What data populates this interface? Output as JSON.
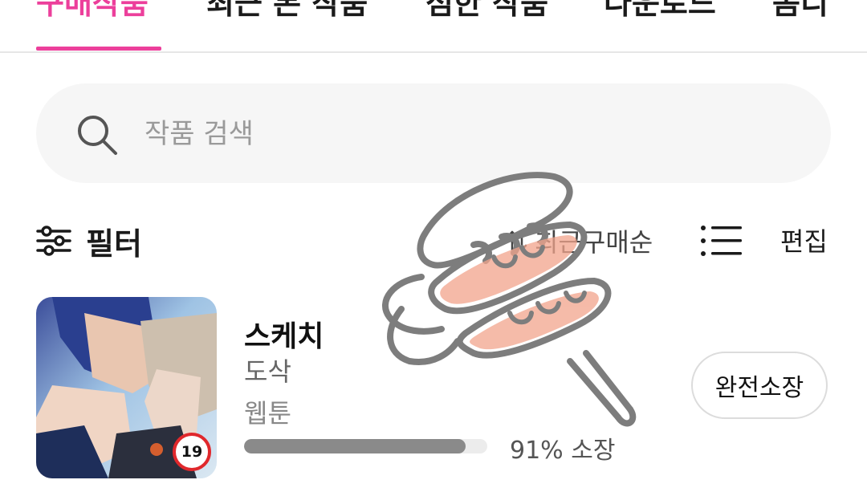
{
  "tabs": [
    {
      "label": "구매작품",
      "active": true
    },
    {
      "label": "최근 본 작품",
      "active": false
    },
    {
      "label": "점한 작품",
      "active": false
    },
    {
      "label": "다운로드",
      "active": false
    },
    {
      "label": "몸디",
      "active": false
    }
  ],
  "search": {
    "placeholder": "작품 검색",
    "icon": "search-icon"
  },
  "toolbar": {
    "filter_label": "필터",
    "sort_label": "최근구매순",
    "edit_label": "편집"
  },
  "items": [
    {
      "title": "스케치",
      "author": "도삭",
      "type": "웹툰",
      "age_rating": "19",
      "progress": 0.91,
      "progress_text": "91% 소장",
      "action_label": "완전소장"
    }
  ],
  "colors": {
    "accent": "#ec3f9b",
    "rating": "#e0282c",
    "doodle": "#f2a48c"
  }
}
